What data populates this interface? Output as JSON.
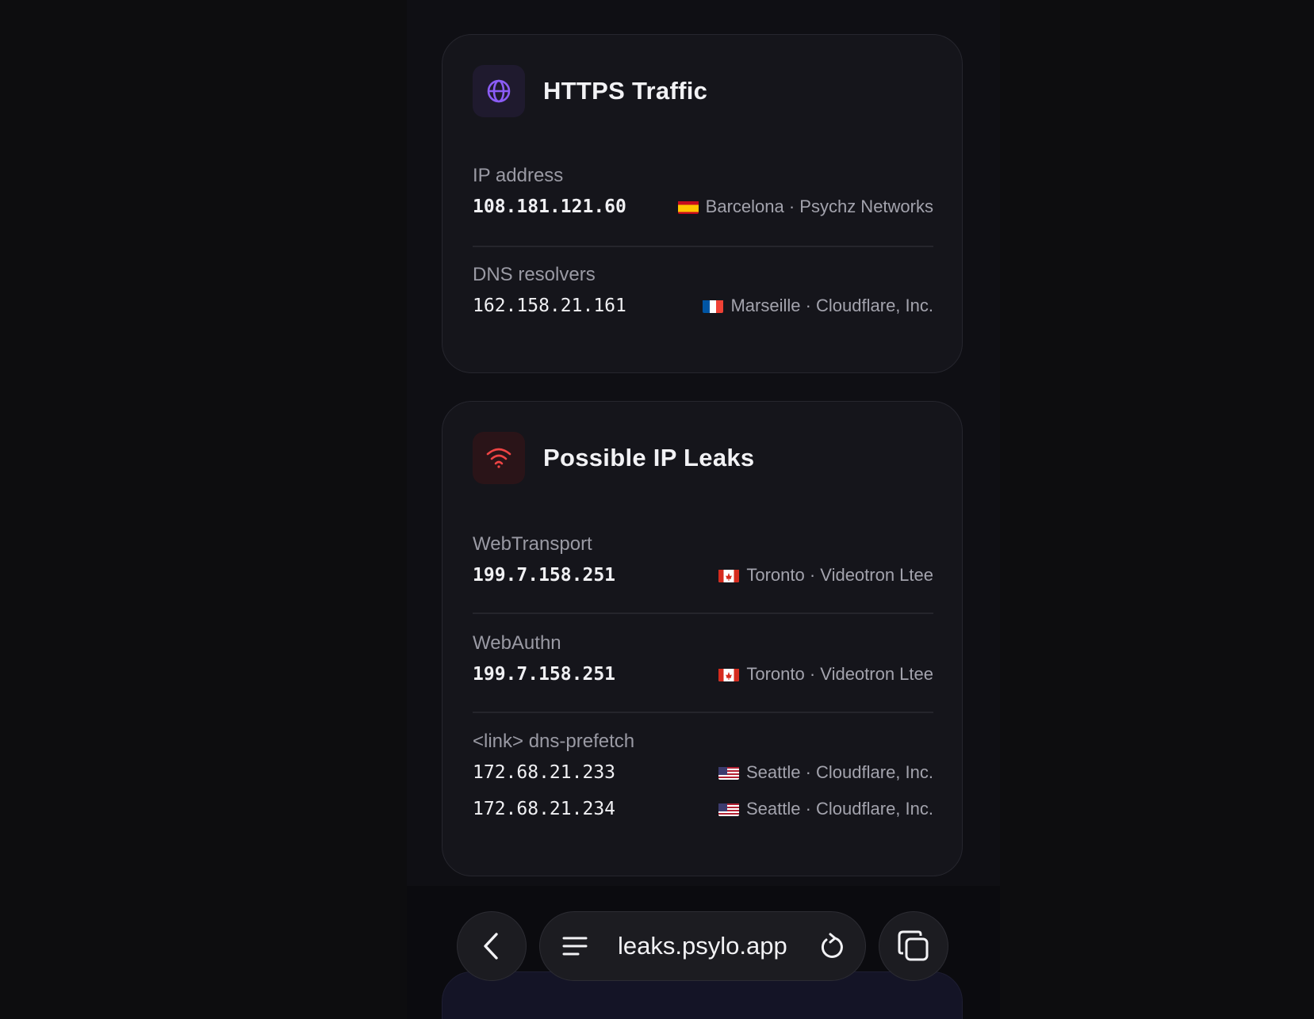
{
  "https_card": {
    "title": "HTTPS Traffic",
    "icon": "globe-icon",
    "accent": "#8b5cf6",
    "sections": [
      {
        "label": "IP address",
        "rows": [
          {
            "ip": "108.181.121.60",
            "flag": "ES",
            "location": "Barcelona · Psychz Networks"
          }
        ]
      },
      {
        "label": "DNS resolvers",
        "rows": [
          {
            "ip": "162.158.21.161",
            "flag": "FR",
            "location": "Marseille · Cloudflare, Inc."
          }
        ]
      }
    ]
  },
  "leaks_card": {
    "title": "Possible IP Leaks",
    "icon": "wifi-icon",
    "accent": "#ef4444",
    "sections": [
      {
        "label": "WebTransport",
        "rows": [
          {
            "ip": "199.7.158.251",
            "flag": "CA",
            "location": "Toronto · Videotron Ltee"
          }
        ]
      },
      {
        "label": "WebAuthn",
        "rows": [
          {
            "ip": "199.7.158.251",
            "flag": "CA",
            "location": "Toronto · Videotron Ltee"
          }
        ]
      },
      {
        "label": "<link> dns-prefetch",
        "rows": [
          {
            "ip": "172.68.21.233",
            "flag": "US",
            "location": "Seattle · Cloudflare, Inc."
          },
          {
            "ip": "172.68.21.234",
            "flag": "US",
            "location": "Seattle · Cloudflare, Inc."
          }
        ]
      }
    ]
  },
  "browser_bar": {
    "url": "leaks.psylo.app",
    "back_icon": "chevron-left-icon",
    "menu_icon": "menu-icon",
    "reload_icon": "reload-icon",
    "tabs_icon": "tabs-icon"
  }
}
